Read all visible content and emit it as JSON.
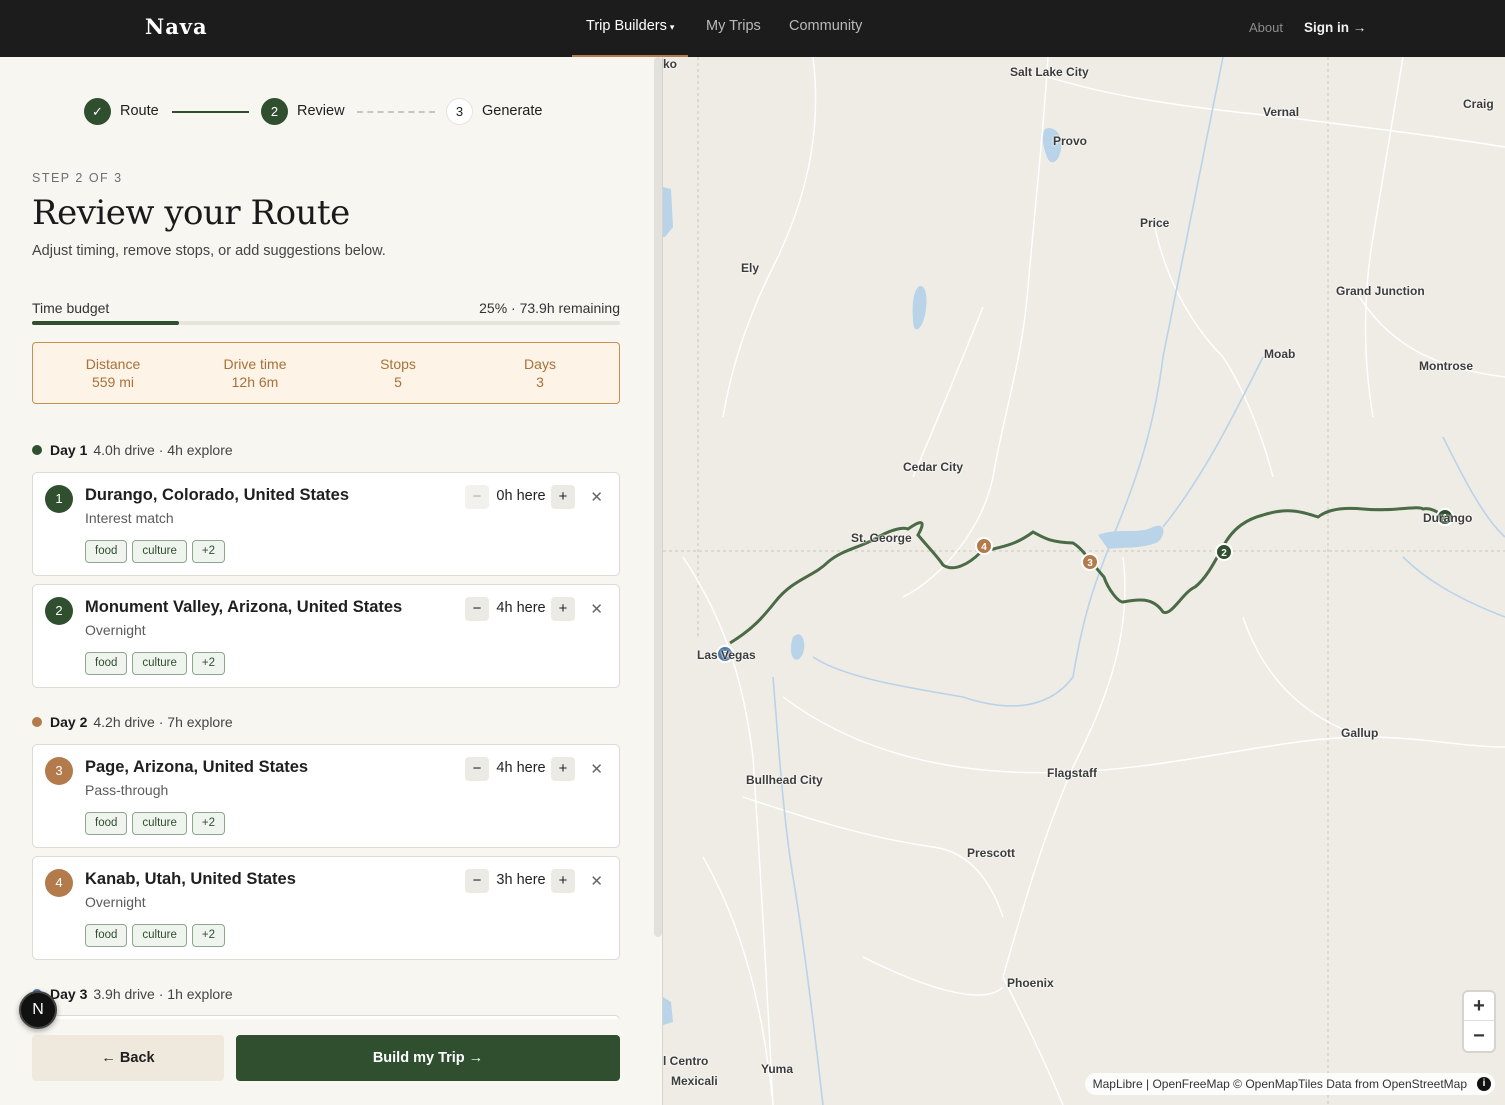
{
  "nav": {
    "brand": "Nava",
    "trip_builders": "Trip Builders",
    "caret": "▾",
    "my_trips": "My Trips",
    "community": "Community",
    "about": "About",
    "sign_in": "Sign in →"
  },
  "stepper": {
    "done_glyph": "✓",
    "steps": [
      {
        "num": "1",
        "label": "Route",
        "state": "done"
      },
      {
        "num": "2",
        "label": "Review",
        "state": "active"
      },
      {
        "num": "3",
        "label": "Generate",
        "state": "todo"
      }
    ]
  },
  "header": {
    "eyebrow": "STEP 2 OF 3",
    "title": "Review your Route",
    "subtitle": "Adjust timing, remove stops, or add suggestions below."
  },
  "budget": {
    "label": "Time budget",
    "value": "25% · 73.9h remaining",
    "fraction": 0.25
  },
  "stats": [
    {
      "label": "Distance",
      "value": "559 mi"
    },
    {
      "label": "Drive time",
      "value": "12h 6m"
    },
    {
      "label": "Stops",
      "value": "5"
    },
    {
      "label": "Days",
      "value": "3"
    }
  ],
  "days": [
    {
      "name": "Day 1",
      "summary": "4.0h drive · 4h explore",
      "color": "#2f4f2f"
    },
    {
      "name": "Day 2",
      "summary": "4.2h drive · 7h explore",
      "color": "#b37a4c"
    },
    {
      "name": "Day 3",
      "summary": "3.9h drive · 1h explore",
      "color": "#4d77a3"
    }
  ],
  "stops": [
    {
      "num": "1",
      "name": "Durango, Colorado, United States",
      "type": "Interest match",
      "hours": "0h here",
      "tags": [
        "food",
        "culture",
        "+2"
      ],
      "color": "#2f4f2f"
    },
    {
      "num": "2",
      "name": "Monument Valley, Arizona, United States",
      "type": "Overnight",
      "hours": "4h here",
      "tags": [
        "food",
        "culture",
        "+2"
      ],
      "color": "#2f4f2f"
    },
    {
      "num": "3",
      "name": "Page, Arizona, United States",
      "type": "Pass-through",
      "hours": "4h here",
      "tags": [
        "food",
        "culture",
        "+2"
      ],
      "color": "#b37a4c"
    },
    {
      "num": "4",
      "name": "Kanab, Utah, United States",
      "type": "Overnight",
      "hours": "3h here",
      "tags": [
        "food",
        "culture",
        "+2"
      ],
      "color": "#b37a4c"
    }
  ],
  "controls": {
    "minus": "−",
    "plus": "+",
    "remove": "✕"
  },
  "footer": {
    "back": "← Back",
    "build": "Build my Trip →",
    "dev_badge": "N"
  },
  "map": {
    "cities": [
      "ko",
      "Salt Lake City",
      "Vernal",
      "Craig",
      "Provo",
      "Price",
      "Ely",
      "Grand Junction",
      "Moab",
      "Montrose",
      "Cedar City",
      "St. George",
      "Las Vegas",
      "Durango",
      "Gallup",
      "Bullhead City",
      "Flagstaff",
      "Prescott",
      "Phoenix",
      "l Centro",
      "Yuma",
      "Mexicali"
    ],
    "markers": [
      "1",
      "2",
      "3",
      "4",
      "5"
    ],
    "zoom_in": "+",
    "zoom_out": "−",
    "attribution": "MapLibre | OpenFreeMap © OpenMapTiles Data from OpenStreetMap",
    "info": "i",
    "route_color": "#4a6b45"
  }
}
